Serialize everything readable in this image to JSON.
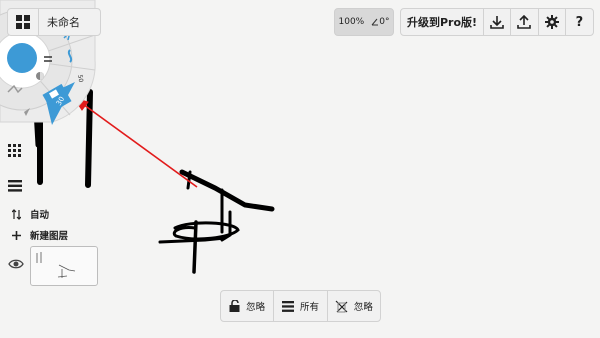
{
  "document": {
    "title": "未命名"
  },
  "view": {
    "zoom": "100%",
    "rotation": "0°"
  },
  "toolbar": {
    "pro_label": "升级到Pro版!"
  },
  "brush_wheel": {
    "size_label": "30",
    "secondary_label": "50"
  },
  "left_panel": {
    "auto_label": "自动",
    "new_layer_label": "新建图层"
  },
  "bottom_bar": {
    "ignore_lock_label": "忽略",
    "all_layers_label": "所有",
    "ignore_ruler_label": "忽略"
  },
  "colors": {
    "accent": "#3d9ad6",
    "arrow": "#e21b1b",
    "stroke": "#000000"
  },
  "icons": [
    "grid-icon",
    "download-icon",
    "upload-icon",
    "gear-icon",
    "help-icon",
    "palette-grid-icon",
    "layers-icon",
    "sort-icon",
    "plus-icon",
    "eye-icon",
    "lock-icon",
    "stack-icon",
    "ruler-off-icon"
  ]
}
